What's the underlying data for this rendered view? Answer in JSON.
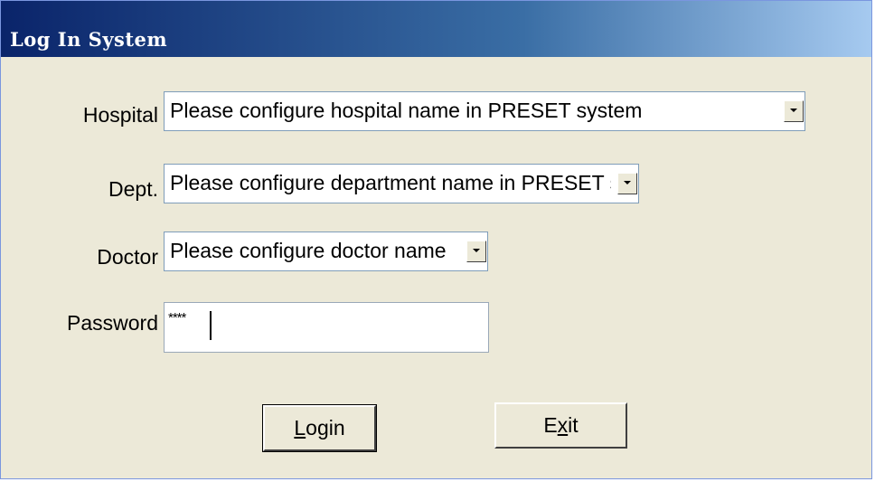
{
  "window": {
    "title": "Log In System"
  },
  "form": {
    "hospital": {
      "label": "Hospital",
      "value": "Please configure hospital name in PRESET system"
    },
    "dept": {
      "label": "Dept.",
      "value": "Please configure department name in PRESET system"
    },
    "doctor": {
      "label": "Doctor",
      "value": "Please configure doctor name"
    },
    "password": {
      "label": "Password",
      "value": "****"
    }
  },
  "buttons": {
    "login": {
      "mnemonic": "L",
      "rest": "ogin"
    },
    "exit": {
      "pre": "E",
      "mnemonic": "x",
      "rest": "it"
    }
  },
  "colors": {
    "titlebar_start": "#0a246a",
    "titlebar_end": "#a6caf0",
    "window_background": "#ece9d8"
  },
  "icons": {
    "dropdown": "chevron-down-icon"
  }
}
